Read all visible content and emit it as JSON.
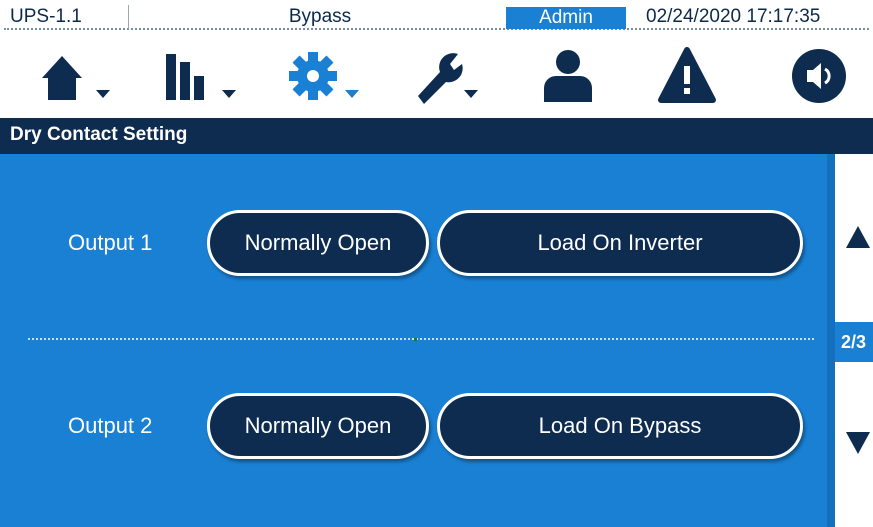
{
  "status_bar": {
    "device": "UPS-1.1",
    "mode": "Bypass",
    "user": "Admin",
    "datetime": "02/24/2020  17:17:35"
  },
  "nav": {
    "icons": [
      "home-icon",
      "measurement-icon",
      "settings-icon",
      "maintenance-icon",
      "user-icon",
      "alarm-icon",
      "sound-icon"
    ]
  },
  "page": {
    "title": "Dry Contact Setting"
  },
  "outputs": [
    {
      "label": "Output 1",
      "mode": "Normally Open",
      "event": "Load On Inverter"
    },
    {
      "label": "Output 2",
      "mode": "Normally Open",
      "event": "Load On Bypass"
    }
  ],
  "pagination": {
    "indicator": "2/3"
  },
  "colors": {
    "navy": "#0e2c4f",
    "blue": "#1a80d4",
    "settings_active": "#1a80d4"
  }
}
